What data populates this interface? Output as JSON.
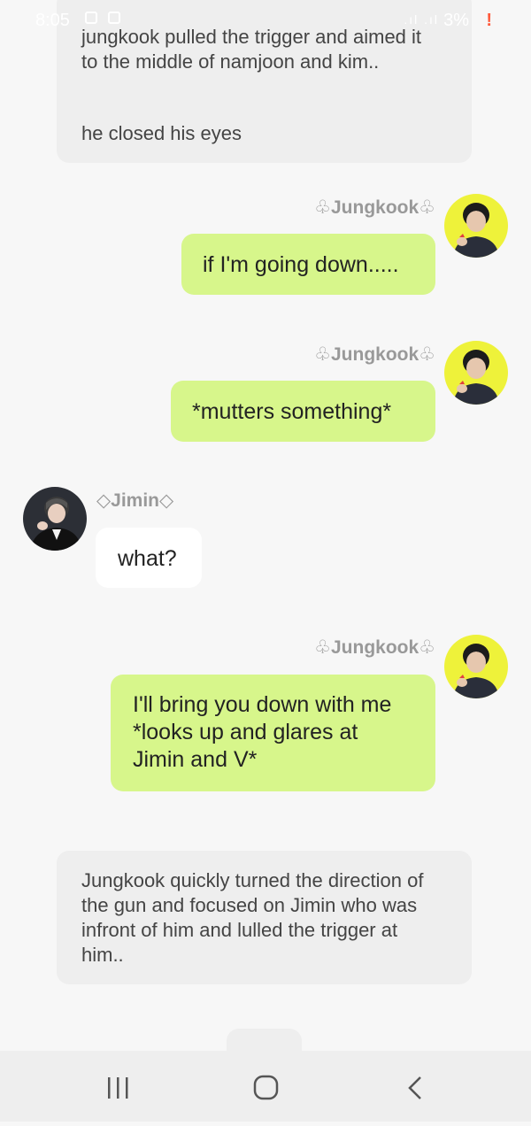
{
  "status_bar": {
    "time": "8:05",
    "battery": "3%",
    "signal": ".ıl .ıl",
    "warning": "!"
  },
  "messages": {
    "narration_1": {
      "line_1": "jungkook pulled the trigger and aimed it",
      "line_2": "to the middle of namjoon and kim..",
      "line_3": "he closed his eyes"
    },
    "jk_name_1": "♧Jungkook♧",
    "jk_msg_1": "if I'm going down.....",
    "jk_name_2": "♧Jungkook♧",
    "jk_msg_2": "*mutters something*",
    "jimin_name": "◇Jimin◇",
    "jimin_msg": "what?",
    "jk_name_3": "♧Jungkook♧",
    "jk_msg_3": {
      "line_1": "I'll bring you down with me",
      "line_2": "*looks up and glares at",
      "line_3": "Jimin and V*"
    },
    "narration_2": {
      "line_1": "Jungkook quickly turned the direction of",
      "line_2": "the gun and focused on Jimin who was",
      "line_3": "infront of him and lulled the trigger at",
      "line_4": "him.."
    }
  },
  "colors": {
    "my_bubble": "#d7f68b",
    "other_bubble": "#ffffff",
    "narration_bg": "#eeeeee",
    "avatar_jungkook_bg": "#eef23a"
  },
  "icons": {
    "nav_recent": "recent-apps-icon",
    "nav_home": "home-icon",
    "nav_back": "back-icon"
  }
}
